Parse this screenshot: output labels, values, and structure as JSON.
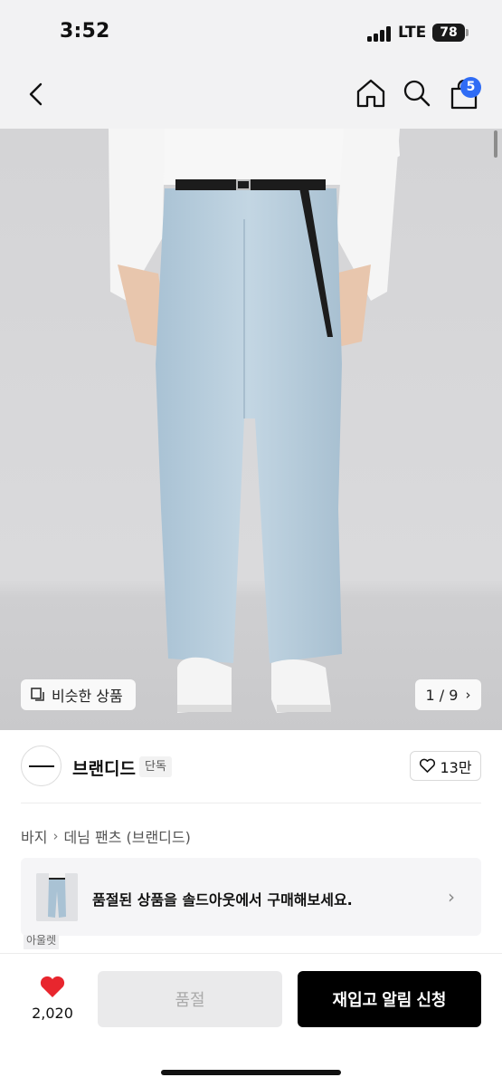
{
  "status_bar": {
    "time": "3:52",
    "network": "LTE",
    "battery": "78"
  },
  "nav": {
    "back_icon": "chevron-left-icon",
    "home_icon": "home-icon",
    "search_icon": "search-icon",
    "cart_icon": "shopping-bag-icon",
    "cart_badge": "5",
    "badge_color": "#2f6cf5"
  },
  "gallery": {
    "similar_label": "비슷한 상품",
    "similar_icon": "copy-icon",
    "page_indicator": "1 / 9",
    "pager_arrow": "›"
  },
  "brand": {
    "name": "브랜디드",
    "tag": "단독",
    "like_count": "13만",
    "like_icon": "heart-outline-icon"
  },
  "breadcrumb": {
    "category": "바지",
    "separator": "›",
    "subcategory": "데님 팬츠 (브랜디드)"
  },
  "soldout_banner": {
    "text": "품절된 상품을 솔드아웃에서 구매해보세요.",
    "arrow": "›"
  },
  "outlet_tag": "아울렛",
  "bottom_bar": {
    "wish_count": "2,020",
    "wish_icon": "heart-filled-icon",
    "wish_color": "#e8262e",
    "soldout_label": "품절",
    "restock_label": "재입고 알림 신청"
  }
}
